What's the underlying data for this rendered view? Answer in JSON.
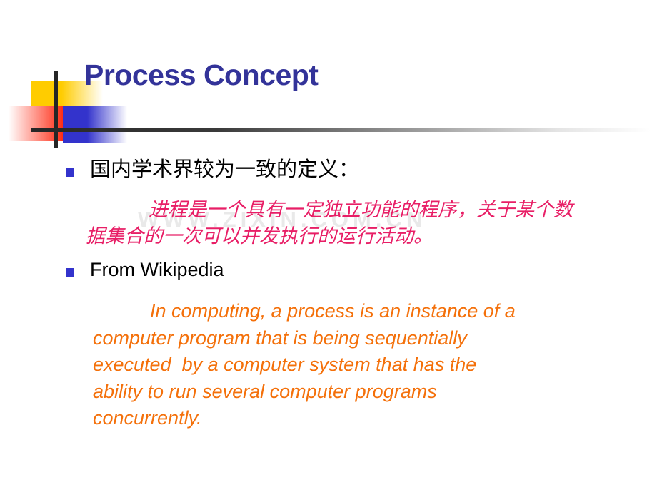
{
  "slide": {
    "title": "Process Concept",
    "watermark": "WWW.ZIXIN.COM.CN",
    "colors": {
      "title": "#333399",
      "bullet_marker": "#3333CC",
      "quote_cn": "#E81E66",
      "quote_en": "#F4700A",
      "deco_yellow": "#FFCC00",
      "deco_red": "#FF2D16",
      "deco_blue": "#3333CC",
      "rule": "#262626",
      "watermark": "#E9E9E9"
    },
    "bullets": [
      {
        "marker": "square-bullet",
        "text": "国内学术界较为一致的定义："
      },
      {
        "marker": "square-bullet",
        "text": "From Wikipedia"
      }
    ],
    "quote_cn": {
      "lines": [
        "进程是一个具有一定独立功能的程序，关于",
        "某个数据集合的一次可以并发执行的运行活动。"
      ]
    },
    "quote_en": {
      "lines": [
        "In computing, a process is an instance of a",
        "computer program that is being sequentially",
        "executed  by a computer system that has the",
        "ability to run several computer programs",
        "concurrently."
      ]
    }
  }
}
